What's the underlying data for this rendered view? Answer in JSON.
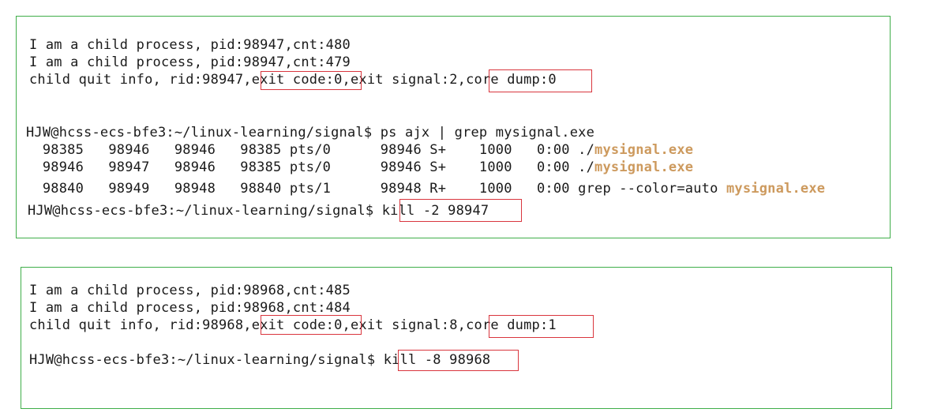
{
  "panel1": {
    "lines": [
      "I am a child process, pid:98947,cnt:480",
      "I am a child process, pid:98947,cnt:479"
    ],
    "quit": {
      "prefix": "child quit info, rid:98947,",
      "exit_code": "exit code:0",
      "middle": ",exit signal:2,",
      "core_dump": "core dump:0"
    },
    "ps_prompt": "HJW@hcss-ecs-bfe3:~/linux-learning/signal$ ps ajx | grep mysignal.exe",
    "ps_rows": [
      {
        "cols": "  98385   98946   98946   98385 pts/0      98946 S+    1000   0:00 ./",
        "match": "mysignal.exe"
      },
      {
        "cols": "  98946   98947   98946   98385 pts/0      98946 S+    1000   0:00 ./",
        "match": "mysignal.exe"
      },
      {
        "cols": "  98840   98949   98948   98840 pts/1      98948 R+    1000   0:00 grep --color=auto ",
        "match": "mysignal.exe"
      }
    ],
    "kill_prompt": "HJW@hcss-ecs-bfe3:~/linux-learning/signal$ ",
    "kill_cmd": "kill -2 98947"
  },
  "panel2": {
    "lines": [
      "I am a child process, pid:98968,cnt:485",
      "I am a child process, pid:98968,cnt:484"
    ],
    "quit": {
      "prefix": "child quit info, rid:98968,",
      "exit_code": "exit code:0",
      "middle": ",exit signal:8,",
      "core_dump": "core dump:1"
    },
    "kill_prompt": "HJW@hcss-ecs-bfe3:~/linux-learning/signal$ ",
    "kill_cmd": "kill -8 98968"
  },
  "colors": {
    "panel_border": "#3fae49",
    "highlight_box": "#d9363e",
    "grep_match": "#cd9a5e"
  }
}
